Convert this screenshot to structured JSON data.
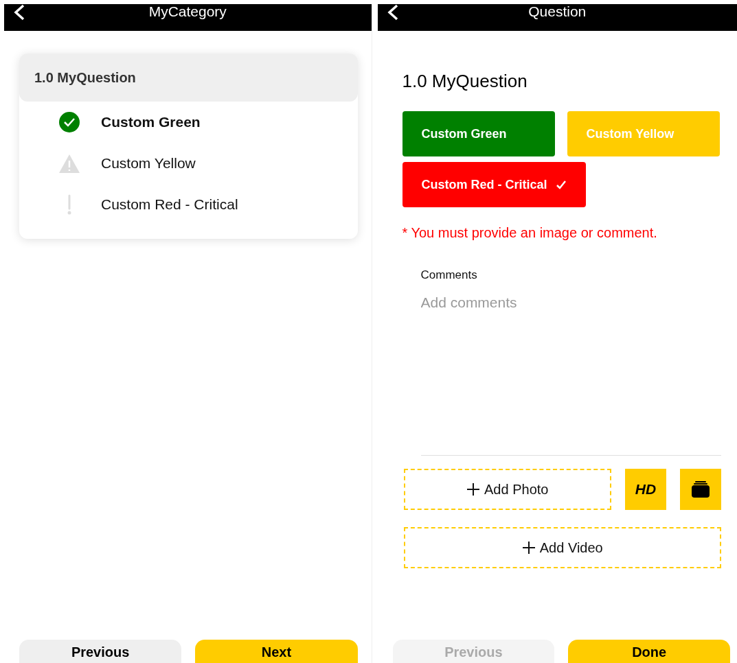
{
  "category_screen": {
    "title": "MyCategory",
    "card": {
      "title": "1.0 MyQuestion",
      "items": [
        {
          "label": "Custom Green",
          "kind": "pass",
          "selected": true
        },
        {
          "label": "Custom Yellow",
          "kind": "warning",
          "selected": false
        },
        {
          "label": "Custom Red - Critical",
          "kind": "critical",
          "selected": false
        }
      ]
    },
    "buttons": [
      {
        "label": "Previous",
        "kind": "secondary",
        "disabled": false
      },
      {
        "label": "Next",
        "kind": "primary",
        "disabled": false
      }
    ]
  },
  "question_screen": {
    "title": "Question",
    "question": "1.0 MyQuestion",
    "options": [
      {
        "label": "Custom Green",
        "color": "#008000",
        "selected": false
      },
      {
        "label": "Custom Yellow",
        "color": "#ffcc00",
        "selected": false
      },
      {
        "label": "Custom Red - Critical",
        "color": "#ff0000",
        "selected": true
      }
    ],
    "error": "* You must provide an image or comment.",
    "comments": {
      "label": "Comments",
      "placeholder": "Add comments"
    },
    "add_photo": "Add Photo",
    "hd_button": "HD",
    "add_video": "Add Video",
    "buttons": [
      {
        "label": "Previous",
        "kind": "secondary",
        "disabled": true
      },
      {
        "label": "Done",
        "kind": "primary",
        "disabled": false
      }
    ]
  }
}
